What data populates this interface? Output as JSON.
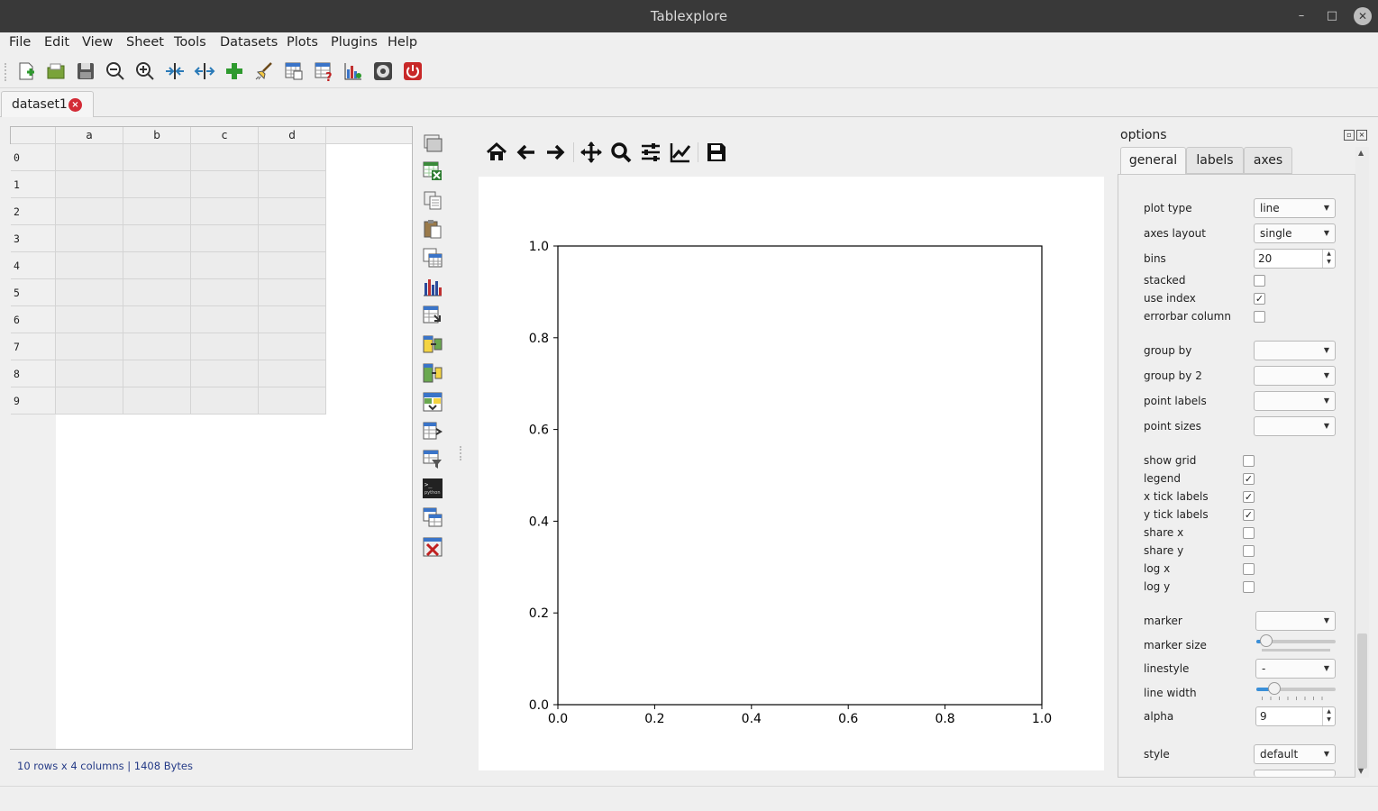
{
  "window": {
    "title": "Tablexplore",
    "minimize": "–",
    "maximize": "□",
    "close": "✕"
  },
  "menu": [
    "File",
    "Edit",
    "View",
    "Sheet",
    "Tools",
    "Datasets",
    "Plots",
    "Plugins",
    "Help"
  ],
  "toolbar_icons": [
    "new-icon",
    "open-icon",
    "save-icon",
    "zoom-out-icon",
    "zoom-in-icon",
    "compress-columns-icon",
    "expand-columns-icon",
    "add-icon",
    "clean-icon",
    "table-preview-icon",
    "table-help-icon",
    "plot-icon",
    "settings-icon",
    "quit-icon"
  ],
  "tab": {
    "label": "dataset1",
    "close": "×"
  },
  "table": {
    "columns": [
      "a",
      "b",
      "c",
      "d"
    ],
    "rows": [
      "0",
      "1",
      "2",
      "3",
      "4",
      "5",
      "6",
      "7",
      "8",
      "9"
    ]
  },
  "status": "10 rows x 4 columns | 1408 Bytes",
  "side_tools": [
    "folder-icon",
    "excel-icon",
    "copy-icon",
    "paste-icon",
    "table-icon",
    "bar-chart-icon",
    "transpose-icon",
    "merge-icon",
    "concat-icon",
    "pivot-icon",
    "table-export-icon",
    "filter-icon",
    "python-icon",
    "table-stack-icon",
    "delete-icon"
  ],
  "plot_toolbar": [
    "home-icon",
    "back-icon",
    "forward-icon",
    "pan-icon",
    "zoom-icon",
    "subplots-icon",
    "edit-axes-icon",
    "save-figure-icon"
  ],
  "chart_data": {
    "type": "line",
    "series": [],
    "xlim": [
      0.0,
      1.0
    ],
    "ylim": [
      0.0,
      1.0
    ],
    "xticks": [
      "0.0",
      "0.2",
      "0.4",
      "0.6",
      "0.8",
      "1.0"
    ],
    "yticks": [
      "0.0",
      "0.2",
      "0.4",
      "0.6",
      "0.8",
      "1.0"
    ],
    "title": "",
    "xlabel": "",
    "ylabel": "",
    "grid": false
  },
  "options": {
    "title": "options",
    "tabs": [
      "general",
      "labels",
      "axes"
    ],
    "fields": {
      "plot_type": {
        "label": "plot type",
        "value": "line"
      },
      "axes_layout": {
        "label": "axes layout",
        "value": "single"
      },
      "bins": {
        "label": "bins",
        "value": "20"
      },
      "stacked": {
        "label": "stacked",
        "checked": false
      },
      "use_index": {
        "label": "use index",
        "checked": true
      },
      "errorbar_column": {
        "label": "errorbar column",
        "checked": false
      },
      "group_by": {
        "label": "group by",
        "value": ""
      },
      "group_by_2": {
        "label": "group by 2",
        "value": ""
      },
      "point_labels": {
        "label": "point labels",
        "value": ""
      },
      "point_sizes": {
        "label": "point sizes",
        "value": ""
      },
      "show_grid": {
        "label": "show grid",
        "checked": false
      },
      "legend": {
        "label": "legend",
        "checked": true
      },
      "x_tick_labels": {
        "label": "x tick labels",
        "checked": true
      },
      "y_tick_labels": {
        "label": "y tick labels",
        "checked": true
      },
      "share_x": {
        "label": "share x",
        "checked": false
      },
      "share_y": {
        "label": "share y",
        "checked": false
      },
      "log_x": {
        "label": "log x",
        "checked": false
      },
      "log_y": {
        "label": "log y",
        "checked": false
      },
      "marker": {
        "label": "marker",
        "value": ""
      },
      "marker_size": {
        "label": "marker size",
        "fraction": 0.05
      },
      "linestyle": {
        "label": "linestyle",
        "value": "-"
      },
      "line_width": {
        "label": "line width",
        "fraction": 0.18
      },
      "alpha": {
        "label": "alpha",
        "value": "9"
      },
      "style": {
        "label": "style",
        "value": "default"
      }
    },
    "check_mark": "✓"
  },
  "colors": {
    "accent": "#3a8fd8",
    "title_bar": "#393939",
    "close_badge": "#d32b36",
    "status_text": "#243a86"
  }
}
